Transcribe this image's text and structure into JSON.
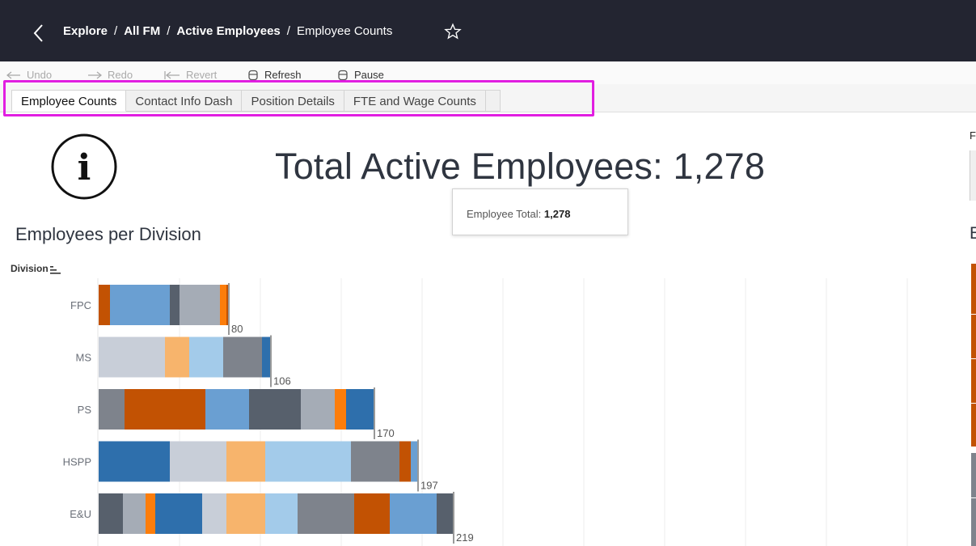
{
  "breadcrumb": {
    "items": [
      "Explore",
      "All FM",
      "Active Employees",
      "Employee Counts"
    ],
    "separator": "/"
  },
  "toolbar": {
    "undo": "Undo",
    "redo": "Redo",
    "revert": "Revert",
    "refresh": "Refresh",
    "pause": "Pause"
  },
  "tabs": [
    {
      "label": "Employee Counts",
      "selected": true
    },
    {
      "label": "Contact Info Dash",
      "selected": false
    },
    {
      "label": "Position Details",
      "selected": false
    },
    {
      "label": "FTE and Wage Counts",
      "selected": false
    }
  ],
  "dashboard": {
    "title": "Total Active Employees: 1,278",
    "tooltip_label": "Employee Total:",
    "tooltip_value": "1,278",
    "section_title": "Employees per Division",
    "axis_title": "Division",
    "right_panel_letter_f": "F",
    "right_panel_letter_e": "E"
  },
  "icons": {
    "back": "chevron-left-icon",
    "favorite": "star-outline-icon",
    "info": "info-circle-icon",
    "sort": "sort-icon"
  },
  "colors": {
    "topbar": "#232531",
    "highlight": "#e11ee1",
    "palette": {
      "dark_orange": "#c25203",
      "orange": "#fc7d0b",
      "light_orange": "#f7b46c",
      "blue": "#2e6fac",
      "mid_blue": "#6a9fd2",
      "light_blue": "#a3cbea",
      "dark_gray": "#57606c",
      "gray": "#7e838c",
      "light_gray": "#a5acb6",
      "pale_gray": "#c8ced8"
    }
  },
  "chart_data": {
    "type": "bar",
    "orientation": "horizontal",
    "stacked": true,
    "xlabel": "",
    "ylabel": "Division",
    "categories": [
      "FPC",
      "MS",
      "PS",
      "HSPP",
      "E&U"
    ],
    "totals": [
      80,
      106,
      170,
      197,
      219
    ],
    "xlim": [
      0,
      500
    ],
    "grid": true,
    "segments": [
      [
        {
          "value": 7,
          "color": "dark_orange"
        },
        {
          "value": 37,
          "color": "mid_blue"
        },
        {
          "value": 6,
          "color": "dark_gray"
        },
        {
          "value": 25,
          "color": "light_gray"
        },
        {
          "value": 4,
          "color": "orange"
        },
        {
          "value": 1,
          "color": "dark_orange"
        }
      ],
      [
        {
          "value": 41,
          "color": "pale_gray"
        },
        {
          "value": 15,
          "color": "light_orange"
        },
        {
          "value": 21,
          "color": "light_blue"
        },
        {
          "value": 24,
          "color": "gray"
        },
        {
          "value": 5,
          "color": "blue"
        }
      ],
      [
        {
          "value": 16,
          "color": "gray"
        },
        {
          "value": 50,
          "color": "dark_orange"
        },
        {
          "value": 27,
          "color": "mid_blue"
        },
        {
          "value": 32,
          "color": "dark_gray"
        },
        {
          "value": 21,
          "color": "light_gray"
        },
        {
          "value": 7,
          "color": "orange"
        },
        {
          "value": 17,
          "color": "blue"
        }
      ],
      [
        {
          "value": 44,
          "color": "blue"
        },
        {
          "value": 35,
          "color": "pale_gray"
        },
        {
          "value": 24,
          "color": "light_orange"
        },
        {
          "value": 53,
          "color": "light_blue"
        },
        {
          "value": 30,
          "color": "gray"
        },
        {
          "value": 7,
          "color": "dark_orange"
        },
        {
          "value": 4,
          "color": "mid_blue"
        }
      ],
      [
        {
          "value": 15,
          "color": "dark_gray"
        },
        {
          "value": 14,
          "color": "light_gray"
        },
        {
          "value": 6,
          "color": "orange"
        },
        {
          "value": 29,
          "color": "blue"
        },
        {
          "value": 15,
          "color": "pale_gray"
        },
        {
          "value": 24,
          "color": "light_orange"
        },
        {
          "value": 20,
          "color": "light_blue"
        },
        {
          "value": 35,
          "color": "gray"
        },
        {
          "value": 22,
          "color": "dark_orange"
        },
        {
          "value": 29,
          "color": "mid_blue"
        },
        {
          "value": 10,
          "color": "dark_gray"
        }
      ]
    ]
  }
}
